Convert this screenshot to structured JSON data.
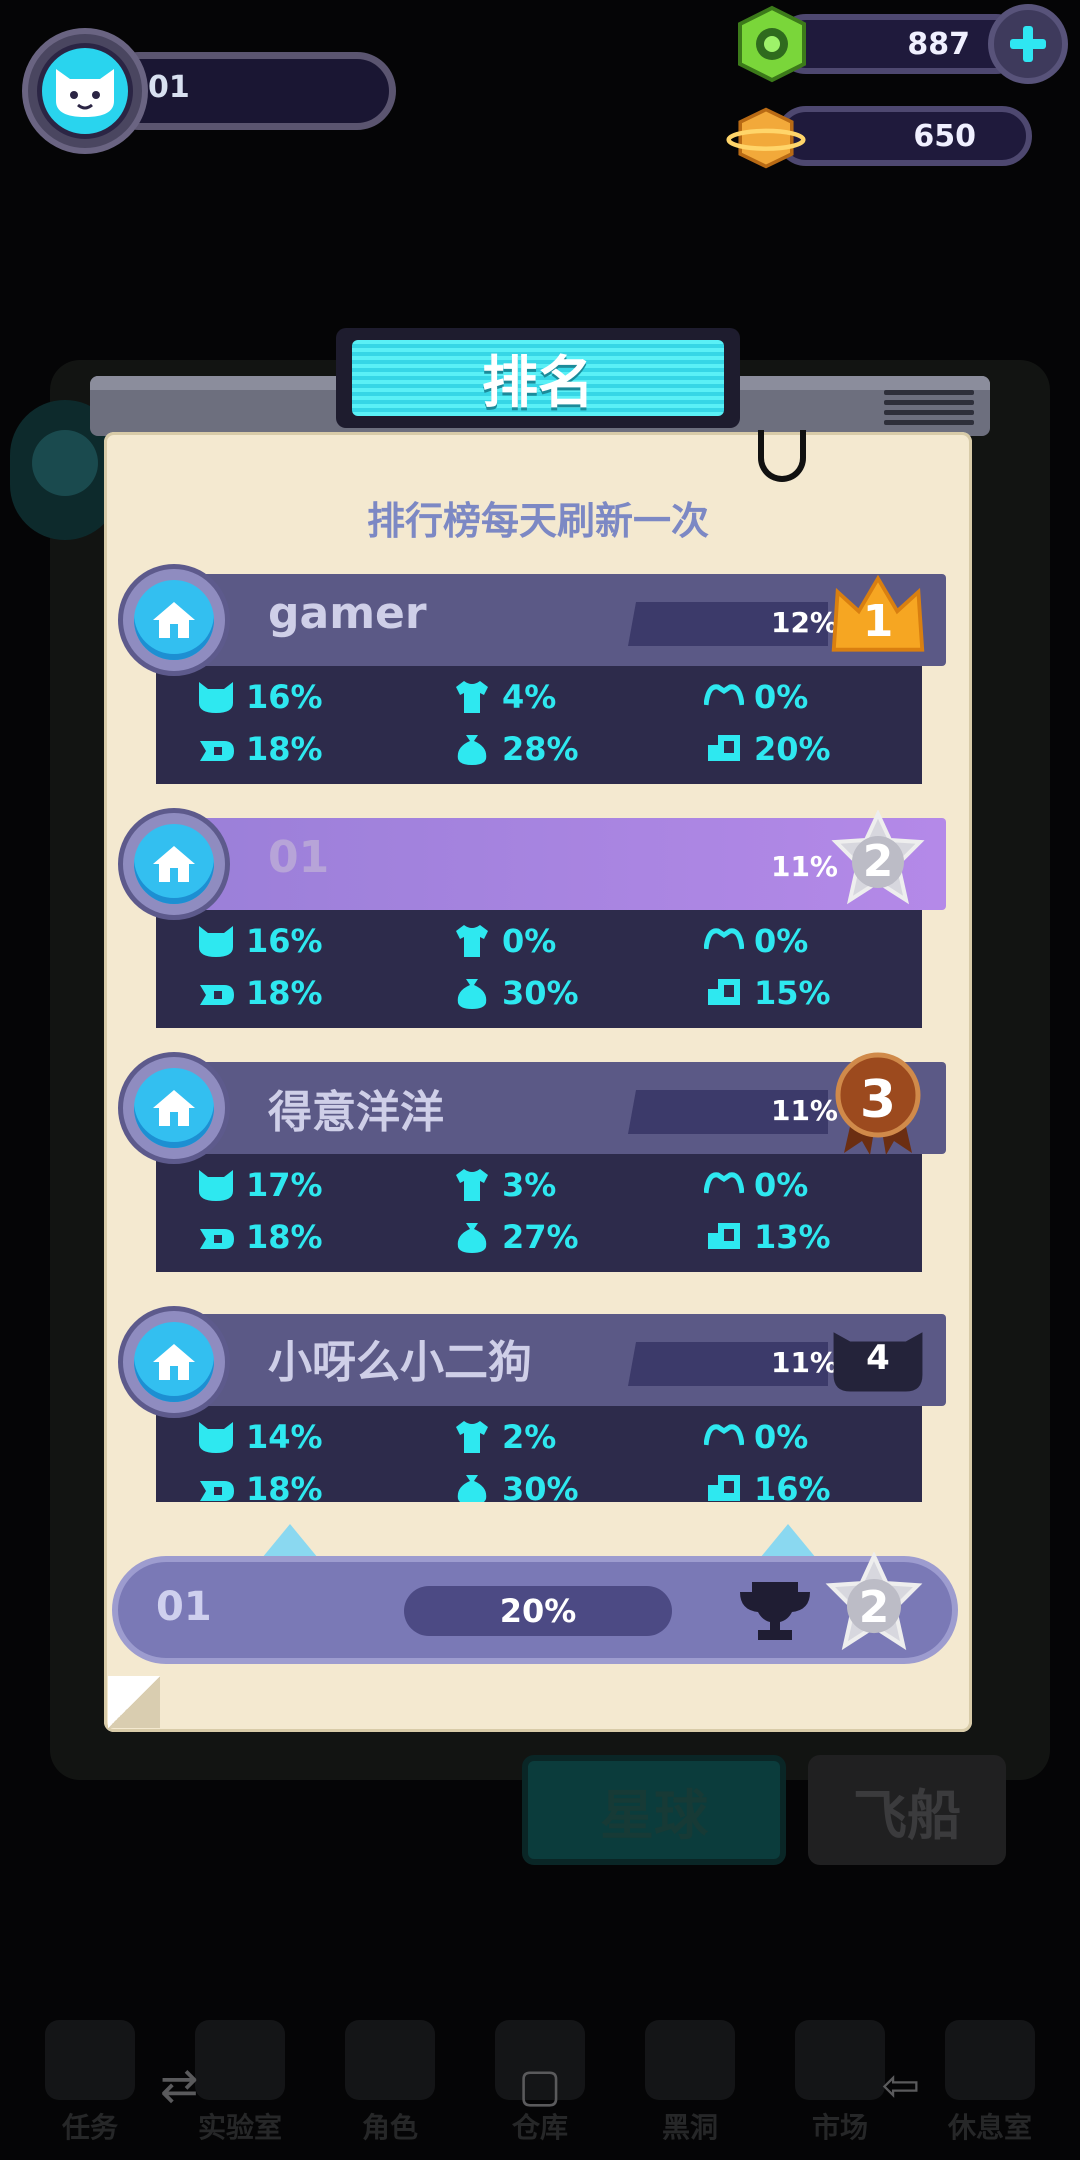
{
  "hud": {
    "player_name": "01",
    "currency_gems": "887",
    "currency_coins": "650"
  },
  "panel": {
    "title": "排名",
    "subtitle": "排行榜每天刷新一次"
  },
  "ranking": [
    {
      "name": "gamer",
      "percent": "12%",
      "rank": "1",
      "medal": "gold-crown",
      "stats": {
        "cat": "16%",
        "shirt": "4%",
        "mask": "0%",
        "ship": "18%",
        "bag": "28%",
        "cart": "20%"
      }
    },
    {
      "name": "01",
      "percent": "11%",
      "rank": "2",
      "medal": "silver-star",
      "stats": {
        "cat": "16%",
        "shirt": "0%",
        "mask": "0%",
        "ship": "18%",
        "bag": "30%",
        "cart": "15%"
      }
    },
    {
      "name": "得意洋洋",
      "percent": "11%",
      "rank": "3",
      "medal": "bronze-ribbon",
      "stats": {
        "cat": "17%",
        "shirt": "3%",
        "mask": "0%",
        "ship": "18%",
        "bag": "27%",
        "cart": "13%"
      }
    },
    {
      "name": "小呀么小二狗",
      "percent": "11%",
      "rank": "4",
      "medal": "cat-badge",
      "stats": {
        "cat": "14%",
        "shirt": "2%",
        "mask": "0%",
        "ship": "18%",
        "bag": "30%",
        "cart": "16%"
      }
    }
  ],
  "my_rank": {
    "name": "01",
    "percent": "20%",
    "rank": "2"
  },
  "scene_buttons": {
    "planet": "星球",
    "ship": "飞船"
  },
  "bottom_tabs": [
    "任务",
    "实验室",
    "角色",
    "仓库",
    "黑洞",
    "市场",
    "休息室"
  ],
  "colors": {
    "stat_text": "#2ee8f0",
    "title_screen": "#44e2ee",
    "paper": "#f4e9d0",
    "name_bar": "#5b5986",
    "highlight_bar": "#a683de"
  }
}
